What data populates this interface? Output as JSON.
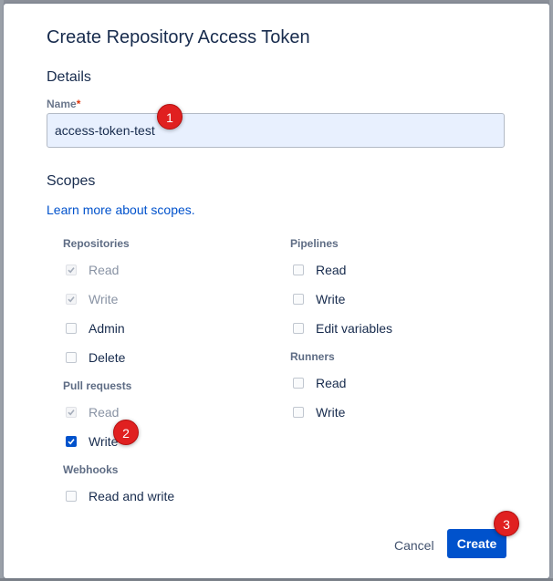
{
  "dialog": {
    "title": "Create Repository Access Token",
    "details_heading": "Details",
    "name_label": "Name",
    "name_required_mark": "*",
    "name_value": "access-token-test",
    "scopes_heading": "Scopes",
    "learn_more_link": "Learn more about scopes."
  },
  "scopes": {
    "repositories": {
      "label": "Repositories",
      "items": [
        {
          "label": "Read",
          "state": "checked-disabled"
        },
        {
          "label": "Write",
          "state": "checked-disabled"
        },
        {
          "label": "Admin",
          "state": "unchecked"
        },
        {
          "label": "Delete",
          "state": "unchecked"
        }
      ]
    },
    "pull_requests": {
      "label": "Pull requests",
      "items": [
        {
          "label": "Read",
          "state": "checked-disabled"
        },
        {
          "label": "Write",
          "state": "checked"
        }
      ]
    },
    "webhooks": {
      "label": "Webhooks",
      "items": [
        {
          "label": "Read and write",
          "state": "unchecked"
        }
      ]
    },
    "pipelines": {
      "label": "Pipelines",
      "items": [
        {
          "label": "Read",
          "state": "unchecked"
        },
        {
          "label": "Write",
          "state": "unchecked"
        },
        {
          "label": "Edit variables",
          "state": "unchecked"
        }
      ]
    },
    "runners": {
      "label": "Runners",
      "items": [
        {
          "label": "Read",
          "state": "unchecked"
        },
        {
          "label": "Write",
          "state": "unchecked"
        }
      ]
    }
  },
  "footer": {
    "cancel_label": "Cancel",
    "create_label": "Create"
  },
  "markers": [
    "1",
    "2",
    "3"
  ],
  "colors": {
    "primary": "#0052cc",
    "marker": "#e02020",
    "input_autofill": "#e8f0fe"
  }
}
